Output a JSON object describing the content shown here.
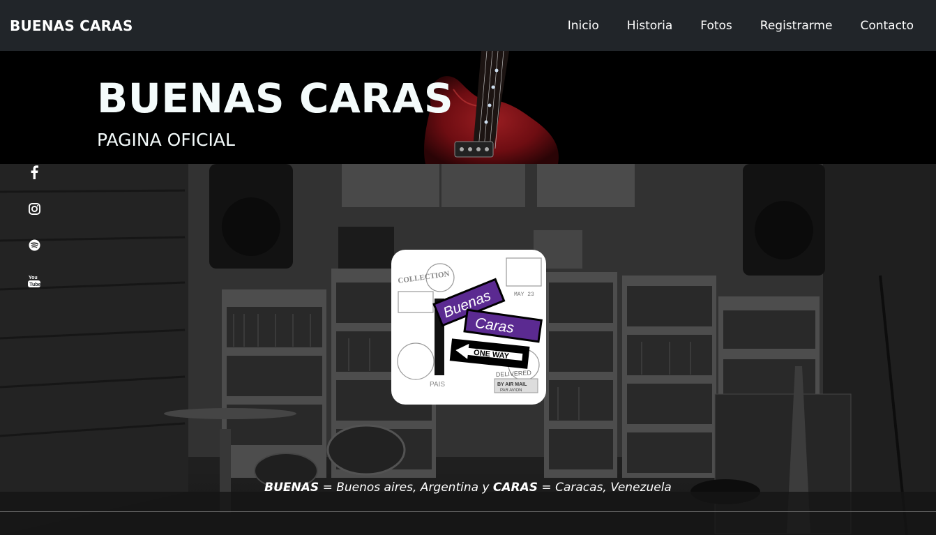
{
  "navbar": {
    "brand": "BUENAS CARAS",
    "links": [
      "Inicio",
      "Historia",
      "Fotos",
      "Registrarme",
      "Contacto"
    ]
  },
  "banner": {
    "title": "BUENAS CARAS",
    "subtitle": "PAGINA OFICIAL"
  },
  "social": {
    "icons": [
      "facebook-icon",
      "instagram-icon",
      "spotify-icon",
      "youtube-icon"
    ]
  },
  "logo": {
    "line1": "Buenas",
    "line2": "Caras",
    "sign": "ONE WAY",
    "stamp1": "COLLECTION",
    "stamp2": "DELIVERED",
    "stamp3": "BY AIR MAIL",
    "stamp4": "PAR AVION",
    "stamp5": "PAIS",
    "stamp6": "MAY 23"
  },
  "tagline": {
    "word1": "BUENAS",
    "text1": " = Buenos aires, Argentina y ",
    "word2": "CARAS",
    "text2": " = Caracas, Venezuela"
  },
  "colors": {
    "navbar_bg": "#212529",
    "sign_purple": "#5b2a91",
    "banner_text": "#f4fbfb"
  }
}
